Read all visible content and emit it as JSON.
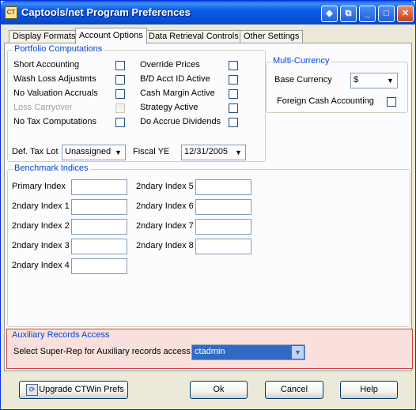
{
  "window": {
    "title": "Captools/net Program Preferences",
    "app_icon": "captools-app-icon"
  },
  "title_buttons": {
    "swap_glyph": "◆",
    "restore_glyph": "⧉",
    "minimize_glyph": "_",
    "maximize_glyph": "□",
    "close_glyph": "✕"
  },
  "tabs": [
    {
      "label": "Display Formats",
      "active": false
    },
    {
      "label": "Account Options",
      "active": true
    },
    {
      "label": "Data Retrieval Controls",
      "active": false
    },
    {
      "label": "Other Settings",
      "active": false
    }
  ],
  "portfolio": {
    "title": "Portfolio Computations",
    "left_options": [
      {
        "label": "Short Accounting",
        "checked": false,
        "enabled": true
      },
      {
        "label": "Wash Loss Adjustmts",
        "checked": false,
        "enabled": true
      },
      {
        "label": "No Valuation  Accruals",
        "checked": false,
        "enabled": true
      },
      {
        "label": "Loss Carryover",
        "checked": false,
        "enabled": false
      },
      {
        "label": "No Tax Computations",
        "checked": false,
        "enabled": true
      }
    ],
    "right_options": [
      {
        "label": "Override Prices",
        "checked": false,
        "enabled": true
      },
      {
        "label": "B/D Acct ID Active",
        "checked": false,
        "enabled": true
      },
      {
        "label": "Cash Margin Active",
        "checked": false,
        "enabled": true
      },
      {
        "label": "Strategy Active",
        "checked": false,
        "enabled": true
      },
      {
        "label": "Do Accrue Dividends",
        "checked": false,
        "enabled": true
      }
    ],
    "def_tax_lot_label": "Def. Tax Lot",
    "def_tax_lot_value": "Unassigned",
    "fiscal_ye_label": "Fiscal YE",
    "fiscal_ye_value": "12/31/2005"
  },
  "multi_currency": {
    "title": "Multi-Currency",
    "base_currency_label": "Base Currency",
    "base_currency_value": "$",
    "foreign_cash_label": "Foreign Cash Accounting",
    "foreign_cash_checked": false
  },
  "benchmark": {
    "title": "Benchmark Indices",
    "left_labels": [
      "Primary Index",
      "2ndary Index 1",
      "2ndary Index 2",
      "2ndary Index 3",
      "2ndary Index 4"
    ],
    "right_labels": [
      "2ndary Index 5",
      "2ndary Index 6",
      "2ndary Index 7",
      "2ndary Index 8"
    ]
  },
  "auxiliary": {
    "title": "Auxiliary Records Access",
    "prompt": "Select Super-Rep for Auxiliary records access:",
    "value": "ctadmin"
  },
  "buttons": {
    "upgrade": "Upgrade CTWin Prefs",
    "ok": "Ok",
    "cancel": "Cancel",
    "help": "Help"
  },
  "icons": {
    "dropdown": "▼"
  }
}
